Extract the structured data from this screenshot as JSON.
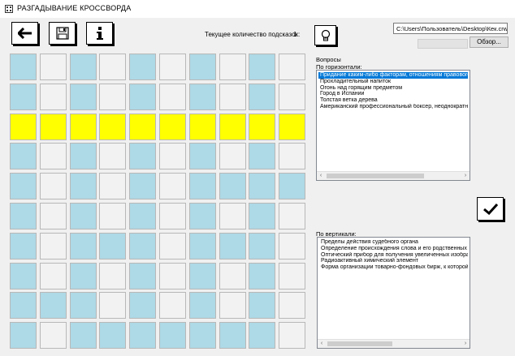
{
  "window": {
    "title": "РАЗГАДЫВАНИЕ КРОССВОРДА",
    "icon": "grid-app-icon"
  },
  "toolbar": {
    "back_icon": "arrow-left-icon",
    "save_icon": "floppy-disk-icon",
    "info_icon": "info-icon",
    "hints_label": "Текущее количество подсказок:",
    "hints_count": "1",
    "hint_icon": "lightbulb-icon",
    "file_path": "C:\\Users\\Пользователь\\Desktop\\Кек.crwd",
    "browse_label": "Обзор..."
  },
  "grid": {
    "rows": [
      "bwbwbwbwbw",
      "bwbwbwbwbw",
      "yyyyyyyyyy",
      "bwbwbwbwbw",
      "bwbwbwbbbb",
      "bwbwbwbwbw",
      "bwbbbwbbbw",
      "bwbwbwbwbw",
      "bbbwbwbwbw",
      "bwbbbbbbbw"
    ],
    "colors": {
      "blue": "#aed9e6",
      "white": "#f2f2f2",
      "yellow": "#ffff00"
    }
  },
  "questions": {
    "group_label": "Вопросы",
    "horizontal_label": "По горизонтали:",
    "horizontal": [
      "Придание каким-либо факторам, отношениям правового значения",
      "Прохладительный напиток",
      "Огонь над горящим предметом",
      "Город в Испании",
      "Толстая ветка дерева",
      "Американский профессиональный боксер, неоднократный чемпион мира"
    ],
    "selected_horizontal": 0,
    "vertical_label": "По вертикали:",
    "vertical": [
      "Пределы действия судебного органа",
      "Определение происхождения слова и его родственных отношений",
      "Оптический прибор для получения увеличенных изображений",
      "Радиоактивный химический элемент",
      "Форма организации товарно-фондовых бирж, к которой принадлежит"
    ]
  },
  "check_icon": "checkmark-icon"
}
